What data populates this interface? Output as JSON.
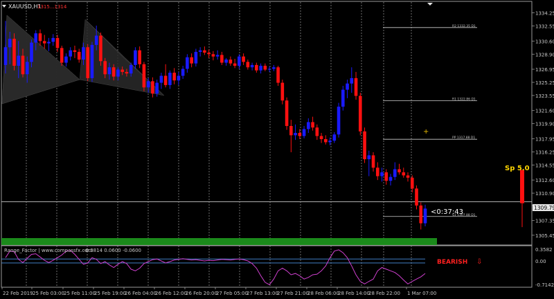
{
  "window": {
    "title": "XAUUSD,H1",
    "header_prices": "1315...1314",
    "collapse_icon": "triangle-down-icon"
  },
  "price_axis": {
    "ticks": [
      "1334.25",
      "1332.55",
      "1330.60",
      "1328.90",
      "1326.95",
      "1325.25",
      "1323.55",
      "1321.60",
      "1319.90",
      "1317.95",
      "1316.25",
      "1314.55",
      "1312.60",
      "1310.90",
      "1309.30",
      "1307.35",
      "1305.45"
    ],
    "current_price_label": "1309.79"
  },
  "time_axis": {
    "ticks": [
      "22 Feb 2019",
      "25 Feb 03:00",
      "25 Feb 11:00",
      "25 Feb 19:00",
      "26 Feb 04:00",
      "26 Feb 12:00",
      "26 Feb 20:00",
      "27 Feb 05:00",
      "27 Feb 13:00",
      "27 Feb 21:00",
      "28 Feb 06:00",
      "28 Feb 14:00",
      "28 Feb 22:00",
      "1 Mar 07:00"
    ]
  },
  "pivot_levels": [
    {
      "label": "R2 1332.35 D1",
      "price": 1332.35
    },
    {
      "label": "R1 1322.86 D1",
      "price": 1322.86
    },
    {
      "label": "PP 1317.88 D1",
      "price": 1317.88
    },
    {
      "label": "S1 1307.88 D1",
      "price": 1307.88
    }
  ],
  "countdown": "<0:37:43",
  "spread_label": "Sp 5.0",
  "indicator": {
    "title": "Range_Factor | www.compassfx.com",
    "values": "-0.3814 0.0600 -0.0600",
    "axis_ticks": [
      "0.3582",
      "0.00",
      "-0.7142"
    ],
    "signal": "BEARISH",
    "signal_arrow": "⇩"
  },
  "colors": {
    "bull": "#1a1aff",
    "bear": "#ff1010",
    "pattern": "#2a2a2a",
    "oscillator": "#d040d0",
    "level_line": "#4a90e0",
    "bottom_bar": "#1b8a1b",
    "spread": "#ffd700",
    "crosshair": "#e6b800"
  },
  "chart_data": {
    "type": "candlestick",
    "symbol": "XAUUSD",
    "timeframe": "H1",
    "ylim": [
      1304.9,
      1335.2
    ],
    "candles": [
      {
        "o": 1327.5,
        "h": 1333.2,
        "l": 1326.4,
        "c": 1329.8
      },
      {
        "o": 1329.8,
        "h": 1331.8,
        "l": 1327.6,
        "c": 1330.9
      },
      {
        "o": 1330.9,
        "h": 1331.6,
        "l": 1326.8,
        "c": 1327.4
      },
      {
        "o": 1327.4,
        "h": 1330.6,
        "l": 1325.8,
        "c": 1328.7
      },
      {
        "o": 1328.7,
        "h": 1329.6,
        "l": 1325.9,
        "c": 1326.3
      },
      {
        "o": 1326.3,
        "h": 1328.6,
        "l": 1325.2,
        "c": 1327.9
      },
      {
        "o": 1327.9,
        "h": 1330.8,
        "l": 1327.2,
        "c": 1330.4
      },
      {
        "o": 1330.4,
        "h": 1332.0,
        "l": 1329.4,
        "c": 1331.6
      },
      {
        "o": 1331.6,
        "h": 1332.1,
        "l": 1330.0,
        "c": 1330.6
      },
      {
        "o": 1330.6,
        "h": 1331.4,
        "l": 1329.6,
        "c": 1330.3
      },
      {
        "o": 1330.3,
        "h": 1331.0,
        "l": 1329.3,
        "c": 1330.5
      },
      {
        "o": 1330.5,
        "h": 1331.5,
        "l": 1330.0,
        "c": 1331.0
      },
      {
        "o": 1331.0,
        "h": 1331.4,
        "l": 1329.2,
        "c": 1329.7
      },
      {
        "o": 1329.7,
        "h": 1330.0,
        "l": 1327.4,
        "c": 1327.8
      },
      {
        "o": 1327.8,
        "h": 1329.0,
        "l": 1327.3,
        "c": 1328.6
      },
      {
        "o": 1328.6,
        "h": 1329.8,
        "l": 1328.1,
        "c": 1329.4
      },
      {
        "o": 1329.4,
        "h": 1330.0,
        "l": 1328.4,
        "c": 1329.2
      },
      {
        "o": 1329.2,
        "h": 1329.6,
        "l": 1327.8,
        "c": 1328.2
      },
      {
        "o": 1328.2,
        "h": 1330.4,
        "l": 1327.5,
        "c": 1329.8
      },
      {
        "o": 1329.8,
        "h": 1330.2,
        "l": 1325.4,
        "c": 1325.8
      },
      {
        "o": 1325.8,
        "h": 1330.5,
        "l": 1325.3,
        "c": 1330.1
      },
      {
        "o": 1330.1,
        "h": 1332.6,
        "l": 1329.4,
        "c": 1331.3
      },
      {
        "o": 1331.3,
        "h": 1331.7,
        "l": 1327.4,
        "c": 1328.0
      },
      {
        "o": 1328.0,
        "h": 1328.4,
        "l": 1325.8,
        "c": 1326.3
      },
      {
        "o": 1326.3,
        "h": 1327.8,
        "l": 1325.6,
        "c": 1327.2
      },
      {
        "o": 1327.2,
        "h": 1327.6,
        "l": 1325.5,
        "c": 1326.0
      },
      {
        "o": 1326.0,
        "h": 1327.2,
        "l": 1325.5,
        "c": 1326.9
      },
      {
        "o": 1326.9,
        "h": 1327.3,
        "l": 1326.2,
        "c": 1326.6
      },
      {
        "o": 1326.6,
        "h": 1327.0,
        "l": 1326.0,
        "c": 1326.4
      },
      {
        "o": 1326.4,
        "h": 1327.8,
        "l": 1326.0,
        "c": 1327.5
      },
      {
        "o": 1327.5,
        "h": 1329.8,
        "l": 1327.0,
        "c": 1329.4
      },
      {
        "o": 1329.4,
        "h": 1329.9,
        "l": 1327.1,
        "c": 1327.6
      },
      {
        "o": 1327.6,
        "h": 1327.9,
        "l": 1324.1,
        "c": 1324.6
      },
      {
        "o": 1324.6,
        "h": 1325.8,
        "l": 1323.9,
        "c": 1325.4
      },
      {
        "o": 1325.4,
        "h": 1325.9,
        "l": 1323.3,
        "c": 1323.8
      },
      {
        "o": 1323.8,
        "h": 1325.6,
        "l": 1323.4,
        "c": 1325.2
      },
      {
        "o": 1325.2,
        "h": 1326.5,
        "l": 1324.4,
        "c": 1326.1
      },
      {
        "o": 1326.1,
        "h": 1327.6,
        "l": 1324.6,
        "c": 1324.9
      },
      {
        "o": 1324.9,
        "h": 1326.8,
        "l": 1324.4,
        "c": 1326.5
      },
      {
        "o": 1326.5,
        "h": 1327.1,
        "l": 1325.0,
        "c": 1325.5
      },
      {
        "o": 1325.5,
        "h": 1326.6,
        "l": 1324.9,
        "c": 1326.1
      },
      {
        "o": 1326.1,
        "h": 1327.4,
        "l": 1325.7,
        "c": 1327.0
      },
      {
        "o": 1327.0,
        "h": 1328.9,
        "l": 1326.5,
        "c": 1328.5
      },
      {
        "o": 1328.5,
        "h": 1329.0,
        "l": 1327.2,
        "c": 1327.7
      },
      {
        "o": 1327.7,
        "h": 1329.6,
        "l": 1327.3,
        "c": 1329.2
      },
      {
        "o": 1329.2,
        "h": 1329.8,
        "l": 1328.6,
        "c": 1329.4
      },
      {
        "o": 1329.4,
        "h": 1329.9,
        "l": 1328.8,
        "c": 1329.1
      },
      {
        "o": 1329.1,
        "h": 1329.5,
        "l": 1328.4,
        "c": 1328.9
      },
      {
        "o": 1328.9,
        "h": 1329.3,
        "l": 1328.1,
        "c": 1328.6
      },
      {
        "o": 1328.6,
        "h": 1329.4,
        "l": 1328.2,
        "c": 1328.8
      },
      {
        "o": 1328.8,
        "h": 1329.2,
        "l": 1327.5,
        "c": 1327.8
      },
      {
        "o": 1327.8,
        "h": 1328.4,
        "l": 1327.4,
        "c": 1328.2
      },
      {
        "o": 1328.2,
        "h": 1328.6,
        "l": 1327.4,
        "c": 1327.7
      },
      {
        "o": 1327.7,
        "h": 1328.3,
        "l": 1327.1,
        "c": 1327.4
      },
      {
        "o": 1327.4,
        "h": 1328.9,
        "l": 1327.0,
        "c": 1328.6
      },
      {
        "o": 1328.6,
        "h": 1329.0,
        "l": 1327.5,
        "c": 1327.9
      },
      {
        "o": 1327.9,
        "h": 1328.2,
        "l": 1326.9,
        "c": 1327.2
      },
      {
        "o": 1327.2,
        "h": 1327.8,
        "l": 1326.8,
        "c": 1327.5
      },
      {
        "o": 1327.5,
        "h": 1327.8,
        "l": 1326.5,
        "c": 1326.8
      },
      {
        "o": 1326.8,
        "h": 1327.7,
        "l": 1326.4,
        "c": 1327.4
      },
      {
        "o": 1327.4,
        "h": 1327.7,
        "l": 1326.7,
        "c": 1326.9
      },
      {
        "o": 1326.9,
        "h": 1327.3,
        "l": 1326.6,
        "c": 1327.0
      },
      {
        "o": 1327.0,
        "h": 1327.5,
        "l": 1326.7,
        "c": 1327.2
      },
      {
        "o": 1327.2,
        "h": 1327.4,
        "l": 1324.8,
        "c": 1325.2
      },
      {
        "o": 1325.2,
        "h": 1325.6,
        "l": 1322.4,
        "c": 1322.9
      },
      {
        "o": 1322.9,
        "h": 1323.3,
        "l": 1319.1,
        "c": 1319.6
      },
      {
        "o": 1319.6,
        "h": 1320.4,
        "l": 1316.2,
        "c": 1318.4
      },
      {
        "o": 1318.4,
        "h": 1319.8,
        "l": 1317.8,
        "c": 1318.7
      },
      {
        "o": 1318.7,
        "h": 1319.2,
        "l": 1317.9,
        "c": 1318.3
      },
      {
        "o": 1318.3,
        "h": 1319.6,
        "l": 1318.0,
        "c": 1319.2
      },
      {
        "o": 1319.2,
        "h": 1320.6,
        "l": 1318.7,
        "c": 1320.1
      },
      {
        "o": 1320.1,
        "h": 1320.8,
        "l": 1319.0,
        "c": 1319.4
      },
      {
        "o": 1319.4,
        "h": 1319.8,
        "l": 1317.8,
        "c": 1318.3
      },
      {
        "o": 1318.3,
        "h": 1318.7,
        "l": 1317.4,
        "c": 1317.9
      },
      {
        "o": 1317.9,
        "h": 1318.4,
        "l": 1317.2,
        "c": 1317.5
      },
      {
        "o": 1317.5,
        "h": 1318.1,
        "l": 1317.1,
        "c": 1317.7
      },
      {
        "o": 1317.7,
        "h": 1318.8,
        "l": 1317.4,
        "c": 1318.5
      },
      {
        "o": 1318.5,
        "h": 1322.6,
        "l": 1318.1,
        "c": 1322.1
      },
      {
        "o": 1322.1,
        "h": 1324.8,
        "l": 1321.6,
        "c": 1324.3
      },
      {
        "o": 1324.3,
        "h": 1325.6,
        "l": 1323.2,
        "c": 1325.1
      },
      {
        "o": 1325.1,
        "h": 1327.2,
        "l": 1323.9,
        "c": 1325.8
      },
      {
        "o": 1325.8,
        "h": 1326.6,
        "l": 1323.0,
        "c": 1323.5
      },
      {
        "o": 1323.5,
        "h": 1323.9,
        "l": 1318.4,
        "c": 1318.9
      },
      {
        "o": 1318.9,
        "h": 1319.4,
        "l": 1314.8,
        "c": 1315.3
      },
      {
        "o": 1315.3,
        "h": 1316.4,
        "l": 1313.1,
        "c": 1315.8
      },
      {
        "o": 1315.8,
        "h": 1316.2,
        "l": 1313.7,
        "c": 1314.2
      },
      {
        "o": 1314.2,
        "h": 1314.9,
        "l": 1312.6,
        "c": 1313.1
      },
      {
        "o": 1313.1,
        "h": 1314.2,
        "l": 1312.4,
        "c": 1313.6
      },
      {
        "o": 1313.6,
        "h": 1314.0,
        "l": 1312.0,
        "c": 1312.5
      },
      {
        "o": 1312.5,
        "h": 1313.4,
        "l": 1311.9,
        "c": 1313.0
      },
      {
        "o": 1313.0,
        "h": 1314.9,
        "l": 1312.6,
        "c": 1314.0
      },
      {
        "o": 1314.0,
        "h": 1314.7,
        "l": 1313.3,
        "c": 1313.6
      },
      {
        "o": 1313.6,
        "h": 1314.2,
        "l": 1312.9,
        "c": 1313.2
      },
      {
        "o": 1313.2,
        "h": 1313.6,
        "l": 1312.4,
        "c": 1312.9
      },
      {
        "o": 1312.9,
        "h": 1313.2,
        "l": 1311.0,
        "c": 1311.5
      },
      {
        "o": 1311.5,
        "h": 1311.9,
        "l": 1308.8,
        "c": 1309.3
      },
      {
        "o": 1309.3,
        "h": 1309.7,
        "l": 1306.2,
        "c": 1307.0
      },
      {
        "o": 1307.0,
        "h": 1309.4,
        "l": 1306.6,
        "c": 1308.9
      }
    ],
    "last_candle": {
      "o": 1313.9,
      "h": 1313.9,
      "l": 1306.5,
      "c": 1309.6
    }
  },
  "oscillator_data": {
    "ylim": [
      -0.7142,
      0.3582
    ],
    "levels": [
      0.06,
      -0.06
    ],
    "values": [
      0.1,
      0.3,
      0.28,
      0.05,
      -0.05,
      0.08,
      0.2,
      0.22,
      0.12,
      0.02,
      -0.05,
      0.02,
      0.1,
      0.18,
      0.3,
      0.32,
      0.2,
      0.05,
      -0.1,
      -0.06,
      0.1,
      0.05,
      -0.08,
      -0.02,
      -0.12,
      -0.2,
      -0.1,
      -0.02,
      -0.08,
      -0.25,
      -0.3,
      -0.22,
      -0.08,
      -0.02,
      0.04,
      0.06,
      0.0,
      -0.06,
      -0.02,
      0.03,
      0.05,
      0.07,
      0.05,
      0.03,
      0.04,
      0.02,
      0.0,
      0.02,
      0.01,
      0.03,
      0.05,
      0.04,
      0.03,
      0.05,
      0.06,
      0.04,
      0.0,
      -0.08,
      -0.22,
      -0.45,
      -0.65,
      -0.72,
      -0.55,
      -0.3,
      -0.22,
      -0.3,
      -0.42,
      -0.38,
      -0.45,
      -0.55,
      -0.5,
      -0.42,
      -0.4,
      -0.3,
      -0.15,
      0.1,
      0.3,
      0.34,
      0.25,
      0.1,
      -0.15,
      -0.42,
      -0.62,
      -0.7,
      -0.62,
      -0.55,
      -0.3,
      -0.2,
      -0.25,
      -0.3,
      -0.35,
      -0.45,
      -0.58,
      -0.7,
      -0.62,
      -0.55,
      -0.48,
      -0.38
    ]
  }
}
